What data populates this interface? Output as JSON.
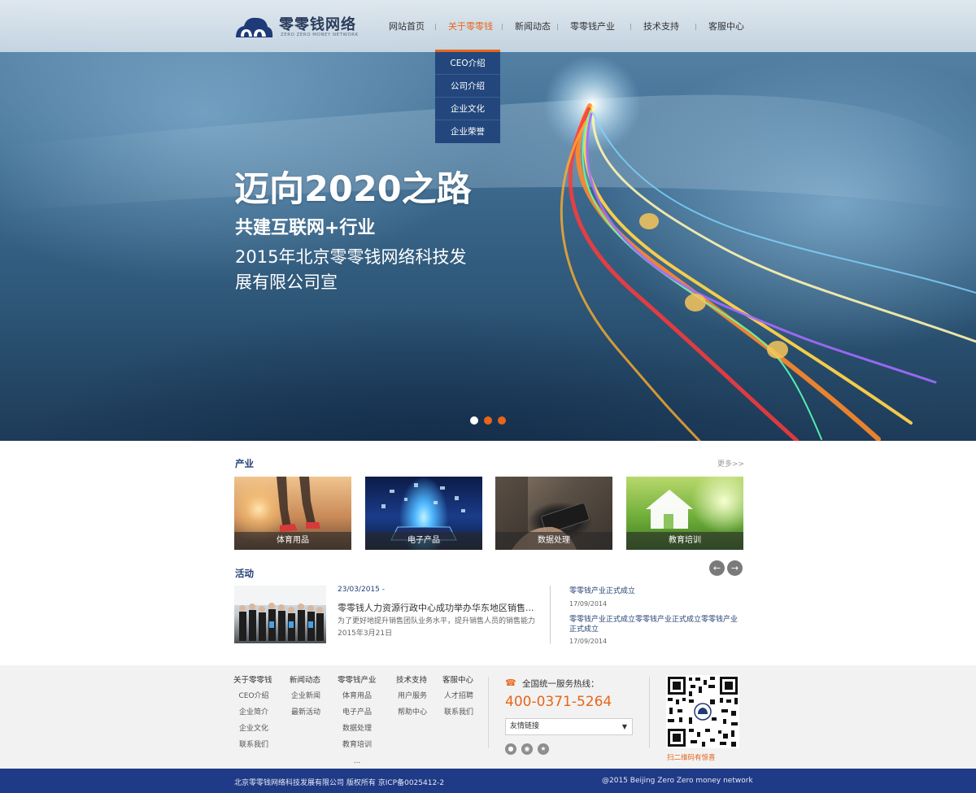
{
  "brand": {
    "name": "零零钱网络",
    "tagline": "ZERO ZERO MONEY NETWORK"
  },
  "nav": {
    "items": [
      {
        "label": "网站首页"
      },
      {
        "label": "关于零零钱"
      },
      {
        "label": "新闻动态"
      },
      {
        "label": "零零钱产业"
      },
      {
        "label": "技术支持"
      },
      {
        "label": "客服中心"
      }
    ],
    "active_index": 1,
    "dropdown": [
      "CEO介绍",
      "公司介绍",
      "企业文化",
      "企业荣誉"
    ]
  },
  "hero": {
    "title": "迈向2020之路",
    "subtitle": "共建互联网+行业",
    "description": "2015年北京零零钱网络科技发展有限公司宣",
    "slides": 3,
    "active_slide": 0
  },
  "industry": {
    "heading": "产业",
    "more": "更多>>",
    "cards": [
      {
        "label": "体育用品"
      },
      {
        "label": "电子产品"
      },
      {
        "label": "数据处理"
      },
      {
        "label": "教育培训"
      }
    ]
  },
  "activity": {
    "heading": "活动",
    "featured": {
      "date": "23/03/2015 -",
      "title": "零零钱人力资源行政中心成功举办华东地区销售...",
      "summary": "为了更好地提升销售团队业务水平，提升销售人员的销售能力2015年3月21日"
    },
    "news": [
      {
        "title": "零零钱产业正式成立",
        "date": "17/09/2014"
      },
      {
        "title": "零零钱产业正式成立零零钱产业正式成立零零钱产业正式成立",
        "date": "17/09/2014"
      }
    ]
  },
  "footer": {
    "columns": [
      {
        "title": "关于零零钱",
        "links": [
          "CEO介绍",
          "企业简介",
          "企业文化",
          "联系我们"
        ]
      },
      {
        "title": "新闻动态",
        "links": [
          "企业新闻",
          "最新活动"
        ]
      },
      {
        "title": "零零钱产业",
        "links": [
          "体育用品",
          "电子产品",
          "数据处理",
          "教育培训",
          "..."
        ]
      },
      {
        "title": "技术支持",
        "links": [
          "用户服务",
          "帮助中心"
        ]
      },
      {
        "title": "客服中心",
        "links": [
          "人才招聘",
          "联系我们"
        ]
      }
    ],
    "hotline_label": "全国统一服务热线：",
    "hotline_number": "400-0371-5264",
    "links_select": "友情链接",
    "social_icons": [
      "qq-icon",
      "weibo-icon",
      "star-icon"
    ],
    "qr_caption": "扫二维码有惊喜",
    "copyright_left": "北京零零钱网络科技发展有限公司  版权所有  京ICP备0025412-2",
    "copyright_right": "@2015 Beijing Zero Zero money network"
  },
  "colors": {
    "accent": "#e8651a",
    "navy": "#233f74",
    "footer_bar": "#1f3a86"
  }
}
